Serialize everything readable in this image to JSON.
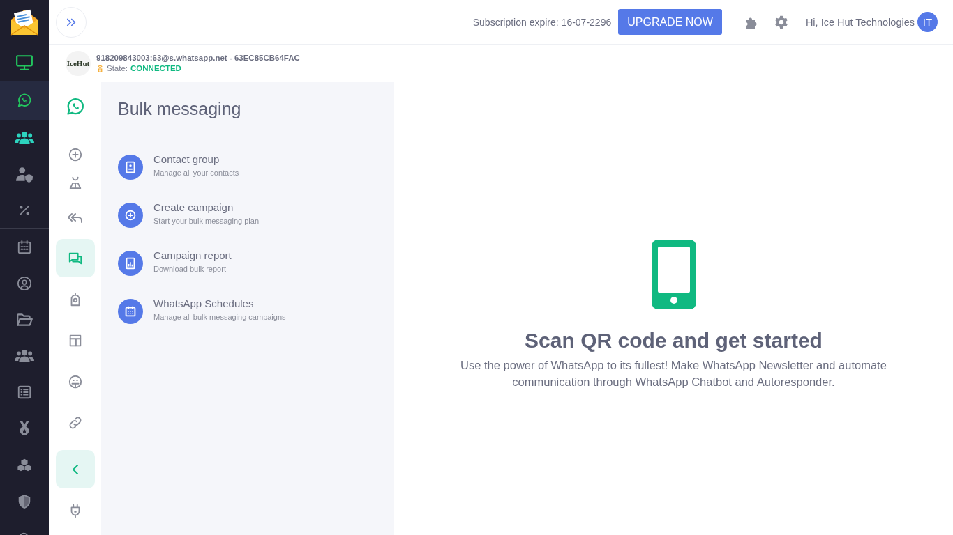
{
  "sidebar": {
    "items": [
      {
        "selected": false
      },
      {
        "selected": true
      },
      {
        "selected": false
      },
      {
        "selected": false
      },
      {
        "selected": false
      },
      {
        "selected": false
      },
      {
        "selected": false
      },
      {
        "selected": false
      },
      {
        "selected": false
      },
      {
        "selected": false
      },
      {
        "selected": false
      },
      {
        "selected": false
      },
      {
        "selected": false
      },
      {
        "selected": false
      }
    ]
  },
  "top_bar": {
    "subscription": "Subscription expire: 16-07-2296",
    "upgrade_button": "UPGRADE NOW",
    "greeting": "Hi, Ice Hut Technologies",
    "avatar_initials": "IT"
  },
  "account": {
    "logo_text": "IceHut",
    "id": "918209843003:63@s.whatsapp.net - 63EC85CB64FAC",
    "state_label": "State:",
    "state_value": "CONNECTED"
  },
  "tool_rail": {
    "items": [
      {
        "selected": false
      },
      {
        "selected": false
      },
      {
        "selected": false
      },
      {
        "selected": false
      },
      {
        "selected": true
      },
      {
        "selected": false
      },
      {
        "selected": false
      },
      {
        "selected": false
      },
      {
        "selected": false
      },
      {
        "selected": true
      },
      {
        "selected": false
      }
    ]
  },
  "panel": {
    "title": "Bulk messaging",
    "items": [
      {
        "title": "Contact group",
        "subtitle": "Manage all your contacts"
      },
      {
        "title": "Create campaign",
        "subtitle": "Start your bulk messaging plan"
      },
      {
        "title": "Campaign report",
        "subtitle": "Download bulk report"
      },
      {
        "title": "WhatsApp Schedules",
        "subtitle": "Manage all bulk messaging campaigns"
      }
    ]
  },
  "empty_state": {
    "heading": "Scan QR code and get started",
    "text": "Use the power of WhatsApp to its fullest! Make WhatsApp Newsletter and automate communication through WhatsApp Chatbot and Autoresponder."
  }
}
